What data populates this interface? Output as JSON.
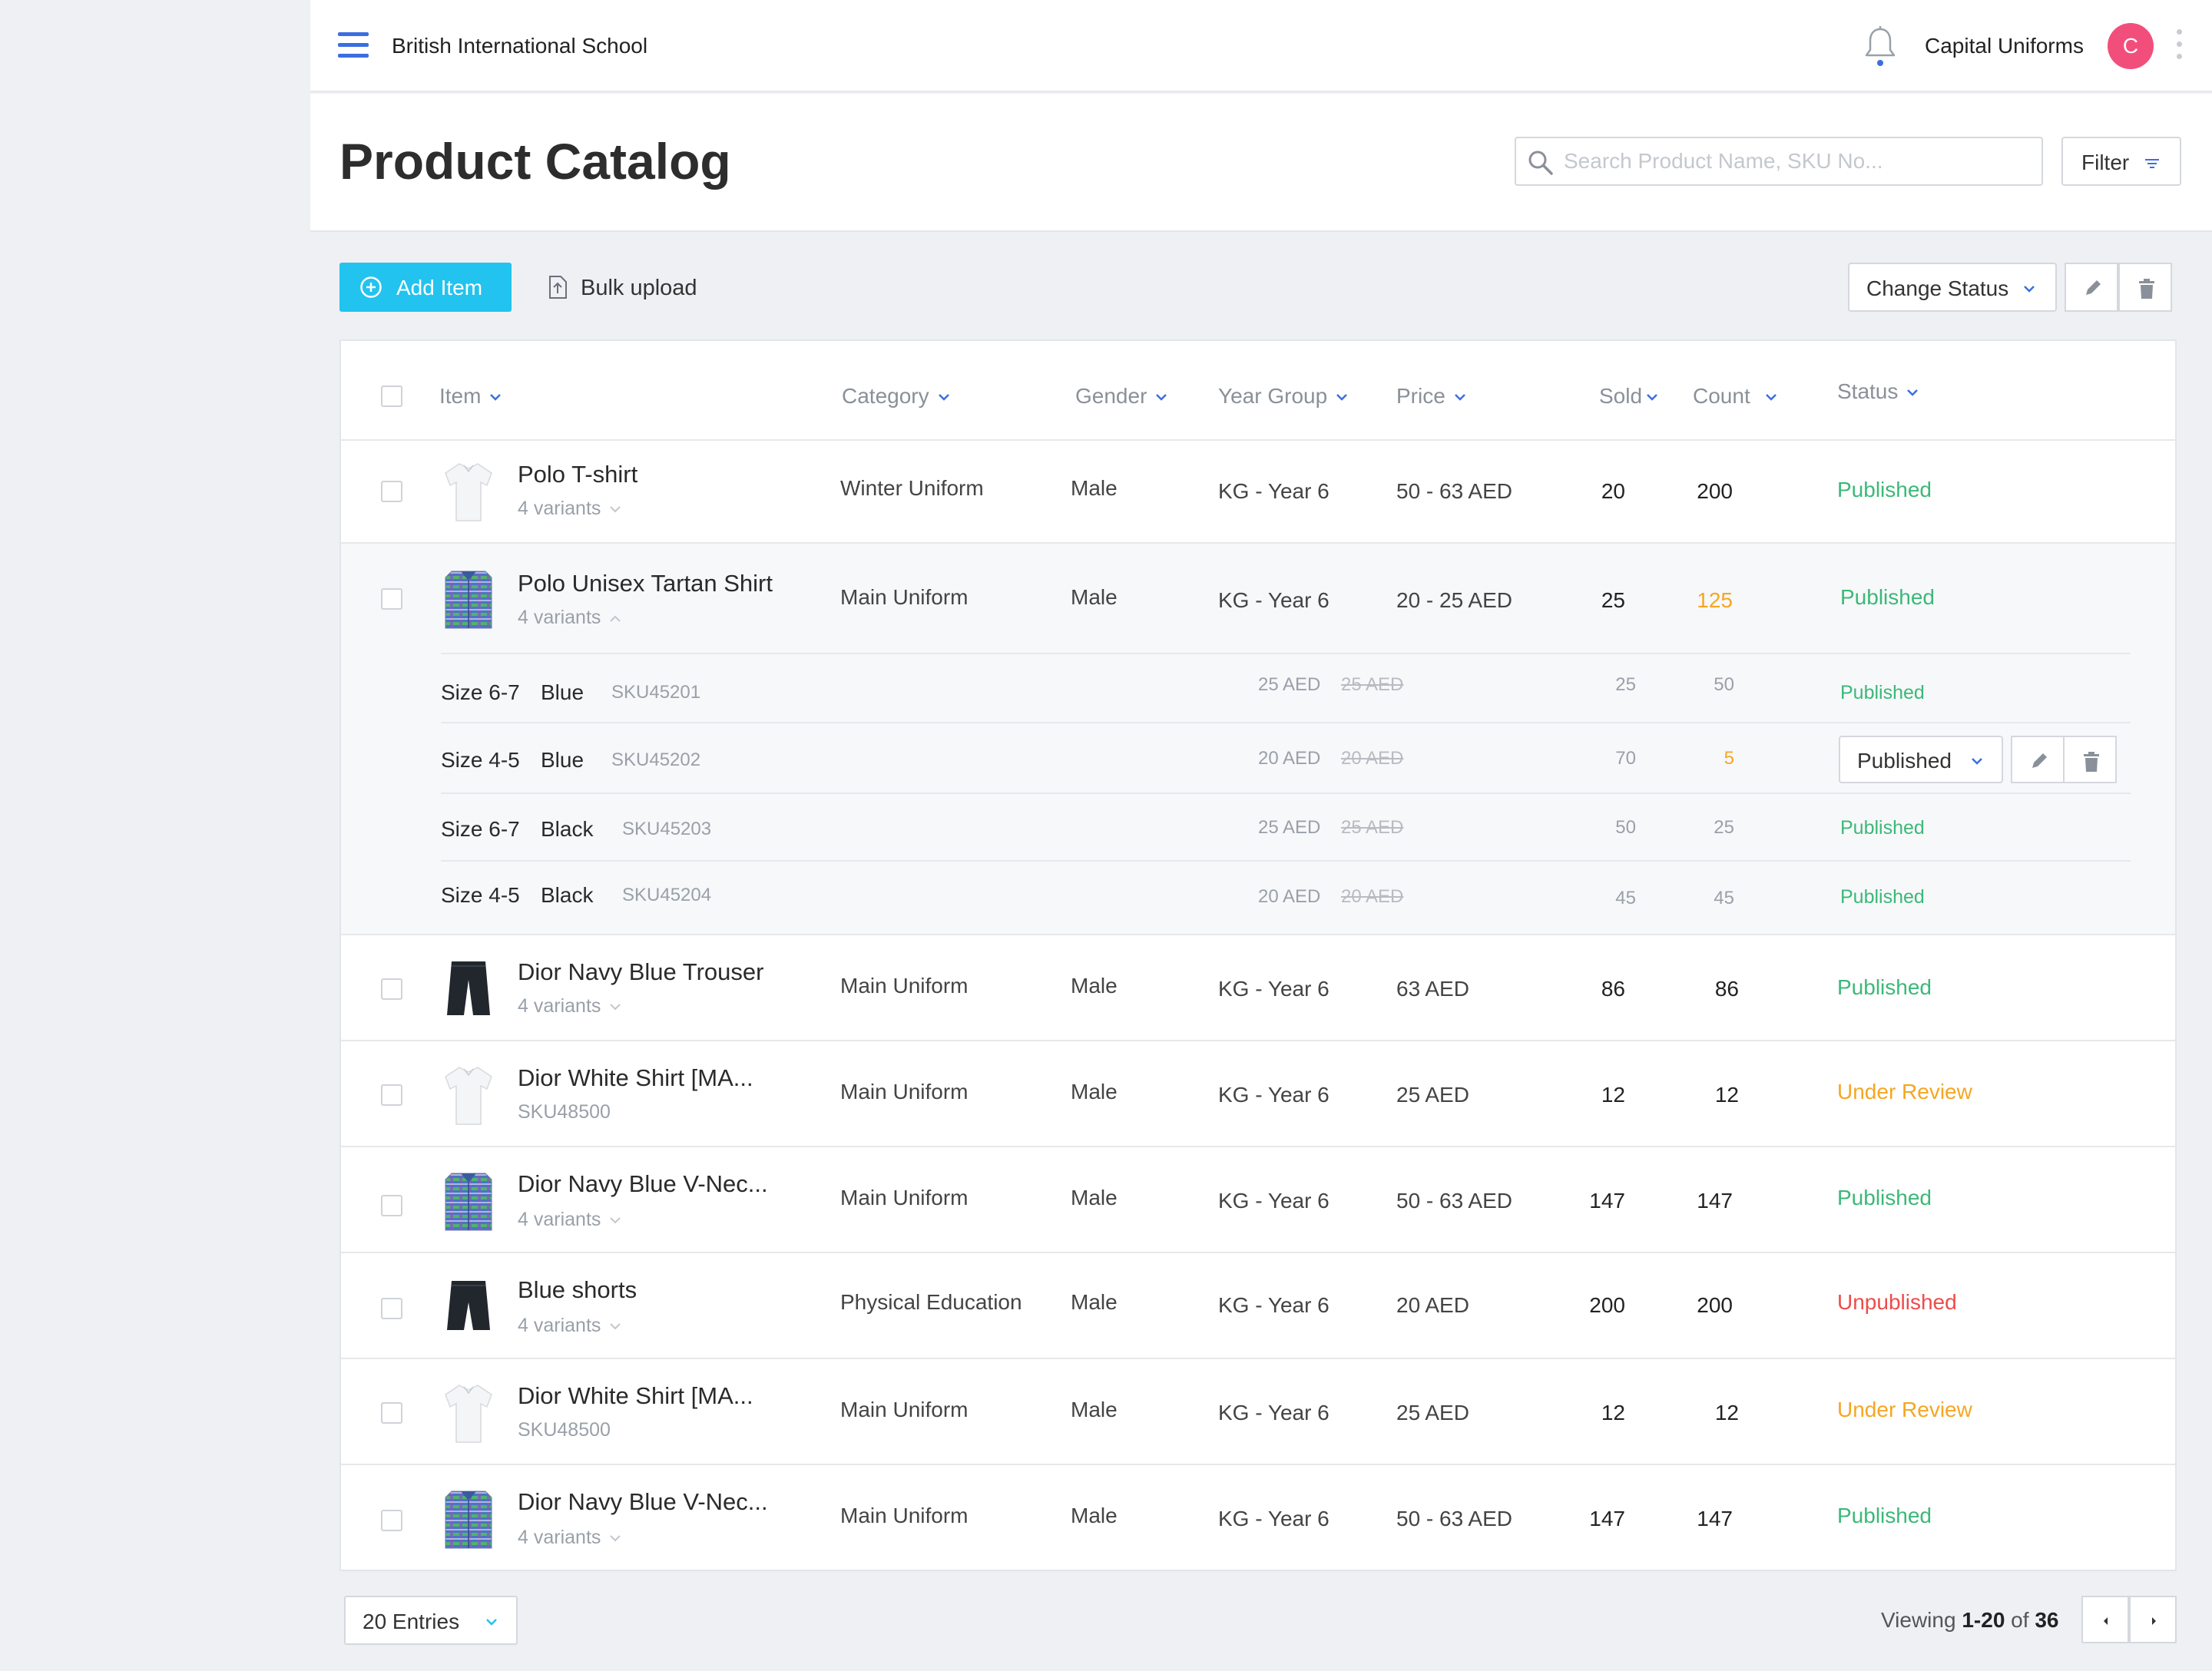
{
  "header": {
    "school_name": "British International School",
    "vendor_name": "Capital Uniforms",
    "avatar_initial": "C"
  },
  "page": {
    "title": "Product Catalog",
    "search_placeholder": "Search Product Name, SKU No...",
    "filter_label": "Filter"
  },
  "toolbar": {
    "add_label": "Add Item",
    "bulk_label": "Bulk upload",
    "change_status_label": "Change Status"
  },
  "columns": {
    "item": "Item",
    "category": "Category",
    "gender": "Gender",
    "year_group": "Year Group",
    "price": "Price",
    "sold": "Sold",
    "count": "Count",
    "status": "Status"
  },
  "rows": [
    {
      "name": "Polo T-shirt",
      "sub": "4 variants",
      "category": "Winter Uniform",
      "gender": "Male",
      "year_group": "KG - Year 6",
      "price": "50 - 63 AED",
      "sold": "20",
      "count": "200",
      "status": "Published"
    },
    {
      "name": "Polo Unisex Tartan Shirt",
      "sub": "4 variants",
      "category": "Main Uniform",
      "gender": "Male",
      "year_group": "KG - Year 6",
      "price": "20 - 25 AED",
      "sold": "25",
      "count": "125",
      "status": "Published",
      "variants": [
        {
          "size": "Size 6-7",
          "color": "Blue",
          "sku": "SKU45201",
          "price": "25 AED",
          "old_price": "25 AED",
          "sold": "25",
          "count": "50",
          "status": "Published"
        },
        {
          "size": "Size 4-5",
          "color": "Blue",
          "sku": "SKU45202",
          "price": "20 AED",
          "old_price": "20 AED",
          "sold": "70",
          "count": "5",
          "status": "Published"
        },
        {
          "size": "Size 6-7",
          "color": "Black",
          "sku": "SKU45203",
          "price": "25 AED",
          "old_price": "25 AED",
          "sold": "50",
          "count": "25",
          "status": "Published"
        },
        {
          "size": "Size 4-5",
          "color": "Black",
          "sku": "SKU45204",
          "price": "20 AED",
          "old_price": "20 AED",
          "sold": "45",
          "count": "45",
          "status": "Published"
        }
      ]
    },
    {
      "name": "Dior Navy Blue Trouser",
      "sub": "4 variants",
      "category": "Main Uniform",
      "gender": "Male",
      "year_group": "KG - Year 6",
      "price": "63 AED",
      "sold": "86",
      "count": "86",
      "status": "Published"
    },
    {
      "name": "Dior White Shirt [MA...",
      "sub": "SKU48500",
      "category": "Main Uniform",
      "gender": "Male",
      "year_group": "KG - Year 6",
      "price": "25 AED",
      "sold": "12",
      "count": "12",
      "status": "Under Review"
    },
    {
      "name": "Dior Navy Blue V-Nec...",
      "sub": "4 variants",
      "category": "Main Uniform",
      "gender": "Male",
      "year_group": "KG - Year 6",
      "price": "50 - 63 AED",
      "sold": "147",
      "count": "147",
      "status": "Published"
    },
    {
      "name": "Blue shorts",
      "sub": "4 variants",
      "category": "Physical Education",
      "gender": "Male",
      "year_group": "KG - Year 6",
      "price": "20 AED",
      "sold": "200",
      "count": "200",
      "status": "Unpublished"
    },
    {
      "name": "Dior White Shirt [MA...",
      "sub": "SKU48500",
      "category": "Main Uniform",
      "gender": "Male",
      "year_group": "KG - Year 6",
      "price": "25 AED",
      "sold": "12",
      "count": "12",
      "status": "Under Review"
    },
    {
      "name": "Dior Navy Blue V-Nec...",
      "sub": "4 variants",
      "category": "Main Uniform",
      "gender": "Male",
      "year_group": "KG - Year 6",
      "price": "50 - 63 AED",
      "sold": "147",
      "count": "147",
      "status": "Published"
    }
  ],
  "footer": {
    "entries_label": "20 Entries",
    "viewing_prefix": "Viewing",
    "viewing_range": "1-20",
    "viewing_of": "of",
    "viewing_total": "36"
  },
  "colors": {
    "accent": "#22c3ee",
    "primary_blue": "#3b6fe0",
    "published": "#3cb878",
    "under_review": "#f5a623",
    "unpublished": "#ef4b4b",
    "avatar": "#f24e7c"
  },
  "icons": {
    "menu": "hamburger-icon",
    "bell": "bell-icon",
    "more": "kebab-icon",
    "search": "search-icon",
    "filter": "filter-icon",
    "add": "plus-circle-icon",
    "upload": "upload-icon",
    "edit": "pencil-icon",
    "delete": "trash-icon"
  }
}
